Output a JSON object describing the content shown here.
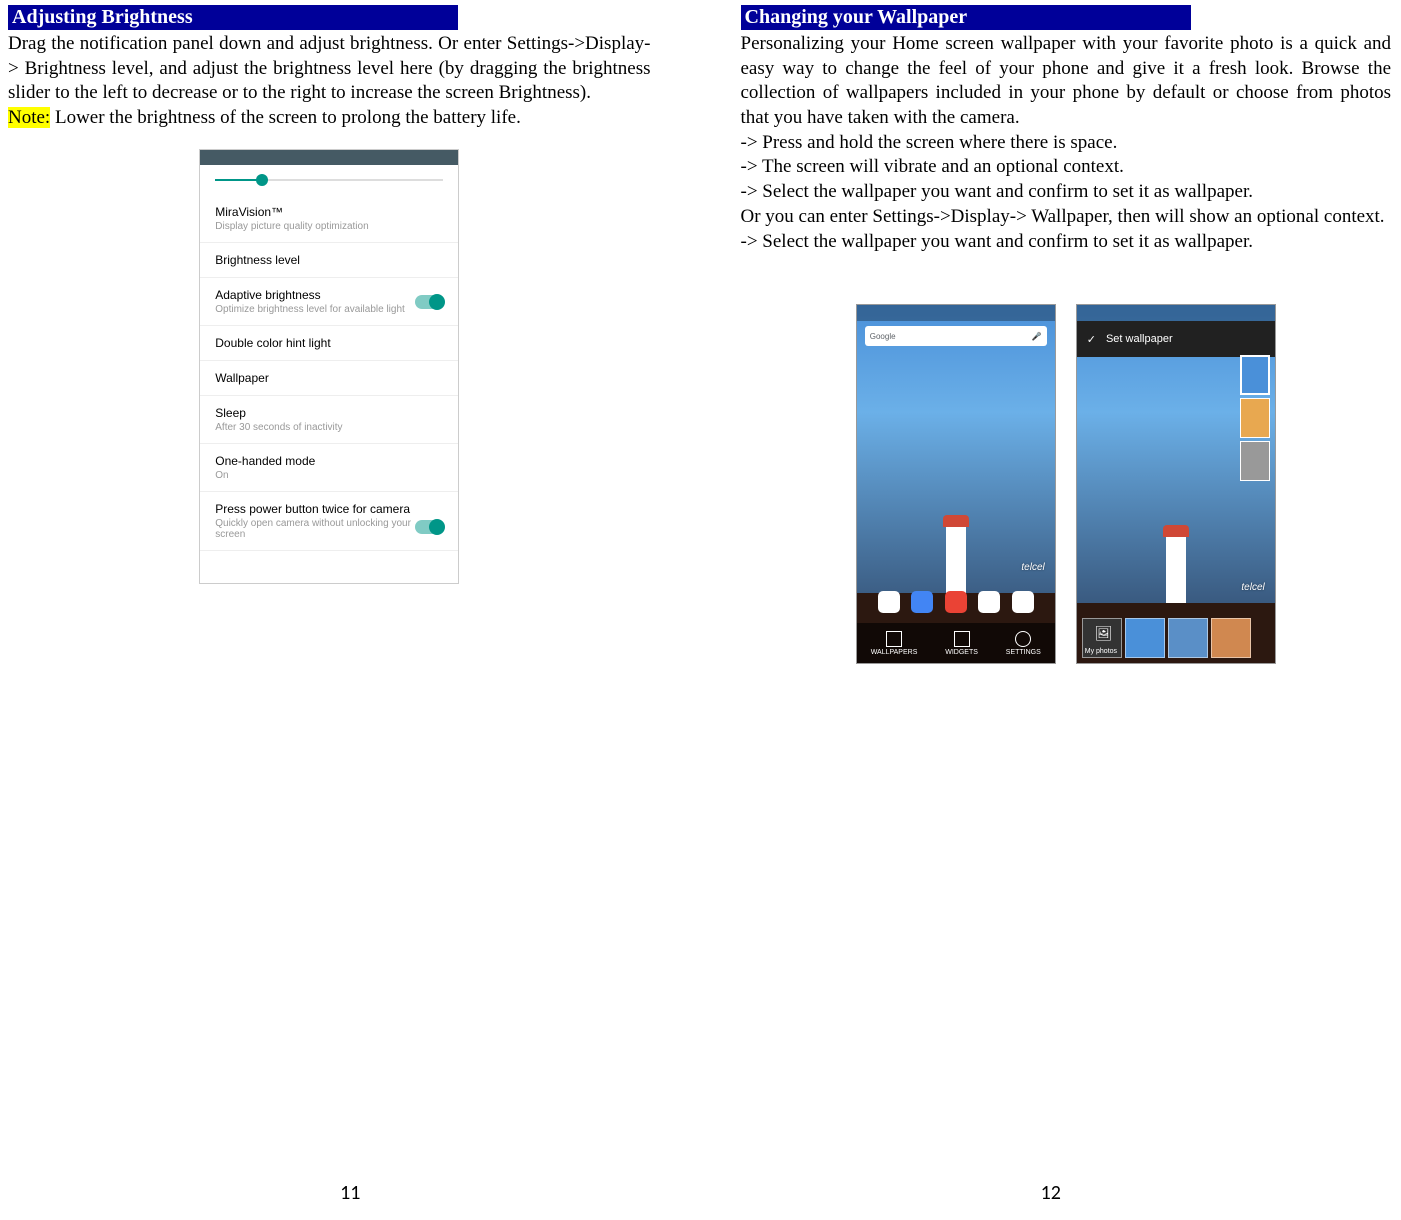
{
  "left_page": {
    "header": "Adjusting Brightness",
    "paragraph": "Drag the notification panel down and adjust brightness. Or enter Settings->Display-> Brightness level, and adjust the brightness level here (by dragging the brightness slider to the left to decrease or to the right to increase the screen Brightness).",
    "note_label": "Note:",
    "note_text": " Lower the brightness of the screen to prolong the battery life.",
    "page_number": "11",
    "screenshot": {
      "items": [
        {
          "title": "MiraVision™",
          "sub": "Display picture quality optimization",
          "toggle": false
        },
        {
          "title": "Brightness level",
          "sub": "",
          "toggle": false
        },
        {
          "title": "Adaptive brightness",
          "sub": "Optimize brightness level for available light",
          "toggle": true
        },
        {
          "title": "Double color hint light",
          "sub": "",
          "toggle": false
        },
        {
          "title": "Wallpaper",
          "sub": "",
          "toggle": false
        },
        {
          "title": "Sleep",
          "sub": "After 30 seconds of inactivity",
          "toggle": false
        },
        {
          "title": "One-handed mode",
          "sub": "On",
          "toggle": false
        },
        {
          "title": "Press power button twice for camera",
          "sub": "Quickly open camera without unlocking your screen",
          "toggle": true
        }
      ]
    }
  },
  "right_page": {
    "header": "Changing your Wallpaper",
    "paragraph": "Personalizing your Home screen wallpaper with your favorite photo is a quick and easy way to change the feel of your phone and give it a fresh look. Browse the collection of wallpapers included in your phone by default or choose from photos that you have taken with the camera.",
    "steps": [
      "-> Press and hold the screen where there is space.",
      "-> The screen will vibrate and an optional context.",
      "-> Select the wallpaper you want and confirm to set it as wallpaper.",
      "Or you can enter Settings->Display-> Wallpaper, then will show an optional context.",
      "-> Select the wallpaper you want and confirm to set it as wallpaper."
    ],
    "page_number": "12",
    "screenshot1": {
      "google_label": "Google",
      "telcel": "telcel",
      "bottom_items": [
        "WALLPAPERS",
        "WIDGETS",
        "SETTINGS"
      ]
    },
    "screenshot2": {
      "header_text": "Set wallpaper",
      "telcel": "telcel",
      "my_photos": "My photos"
    }
  }
}
